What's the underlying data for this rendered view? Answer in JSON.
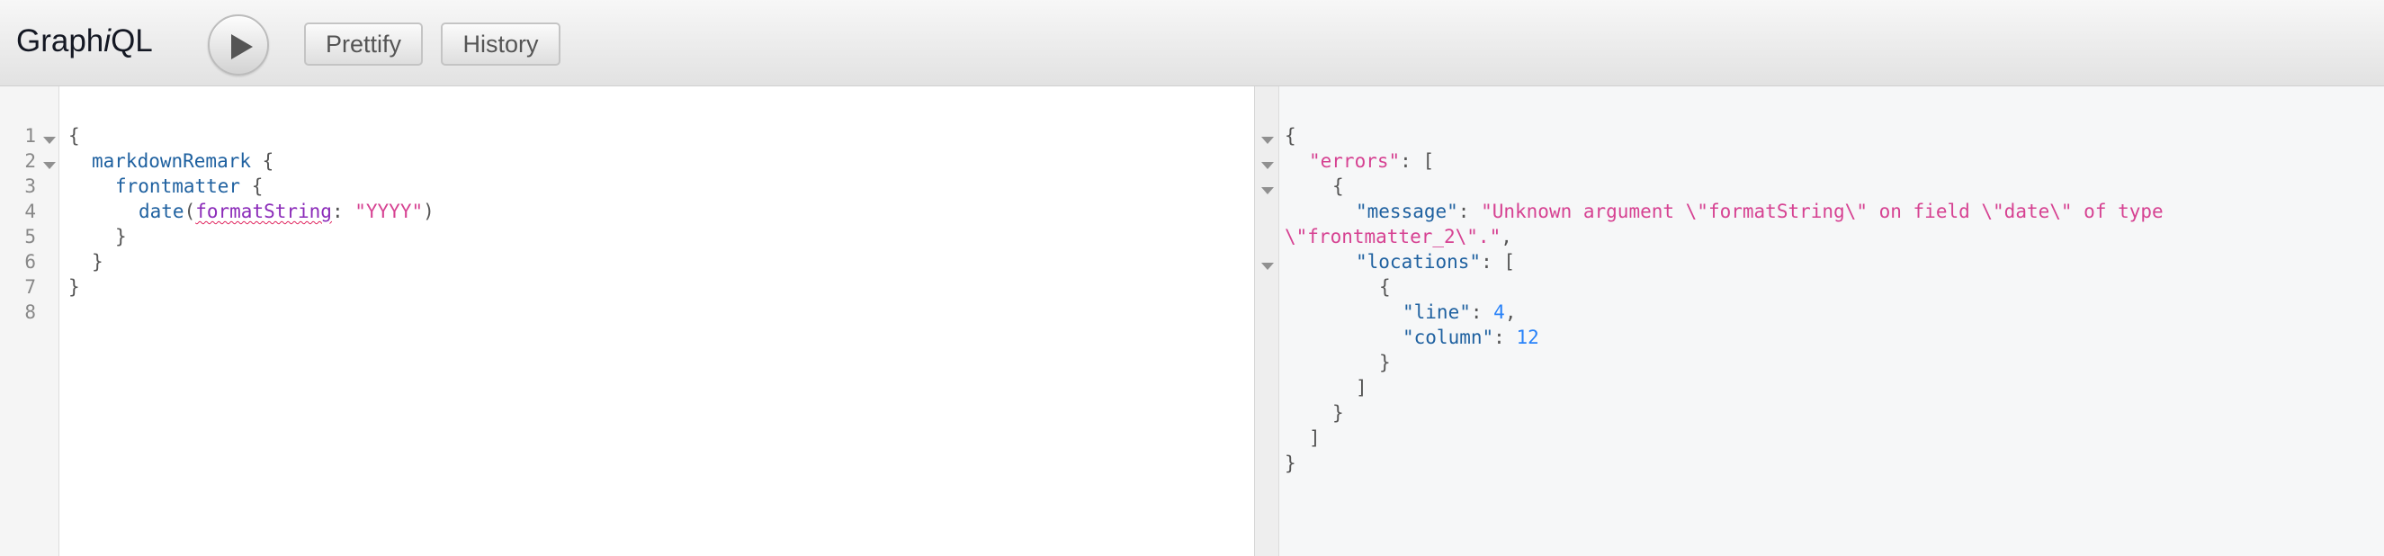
{
  "app": {
    "title_prefix": "Graph",
    "title_italic": "i",
    "title_suffix": "QL"
  },
  "toolbar": {
    "run_icon": "play-icon",
    "prettify_label": "Prettify",
    "history_label": "History"
  },
  "query_editor": {
    "line_numbers": [
      "1",
      "2",
      "3",
      "4",
      "5",
      "6",
      "7",
      "8"
    ],
    "lines": {
      "l1_open": "{",
      "l2_field": "markdownRemark",
      "l2_brace": " {",
      "l3_field": "frontmatter",
      "l3_brace": " {",
      "l4_field": "date",
      "l4_paren_open": "(",
      "l4_arg": "formatString",
      "l4_colon": ": ",
      "l4_value": "\"YYYY\"",
      "l4_paren_close": ")",
      "l5_close": "}",
      "l6_close": "}",
      "l7_close": "}"
    }
  },
  "result_viewer": {
    "l1": "{",
    "l2_key": "\"errors\"",
    "l2_rest": ": [",
    "l3": "{",
    "l4_key": "\"message\"",
    "l4_colon": ": ",
    "l4_value": "\"Unknown argument \\\"formatString\\\" on field \\\"date\\\" of type",
    "l5_value": "\\\"frontmatter_2\\\".\"",
    "l5_comma": ",",
    "l6_key": "\"locations\"",
    "l6_rest": ": [",
    "l7": "{",
    "l8_key": "\"line\"",
    "l8_colon": ": ",
    "l8_value": "4",
    "l8_comma": ",",
    "l9_key": "\"column\"",
    "l9_colon": ": ",
    "l9_value": "12",
    "l10": "}",
    "l11": "]",
    "l12": "}",
    "l13": "]",
    "l14": "}"
  }
}
